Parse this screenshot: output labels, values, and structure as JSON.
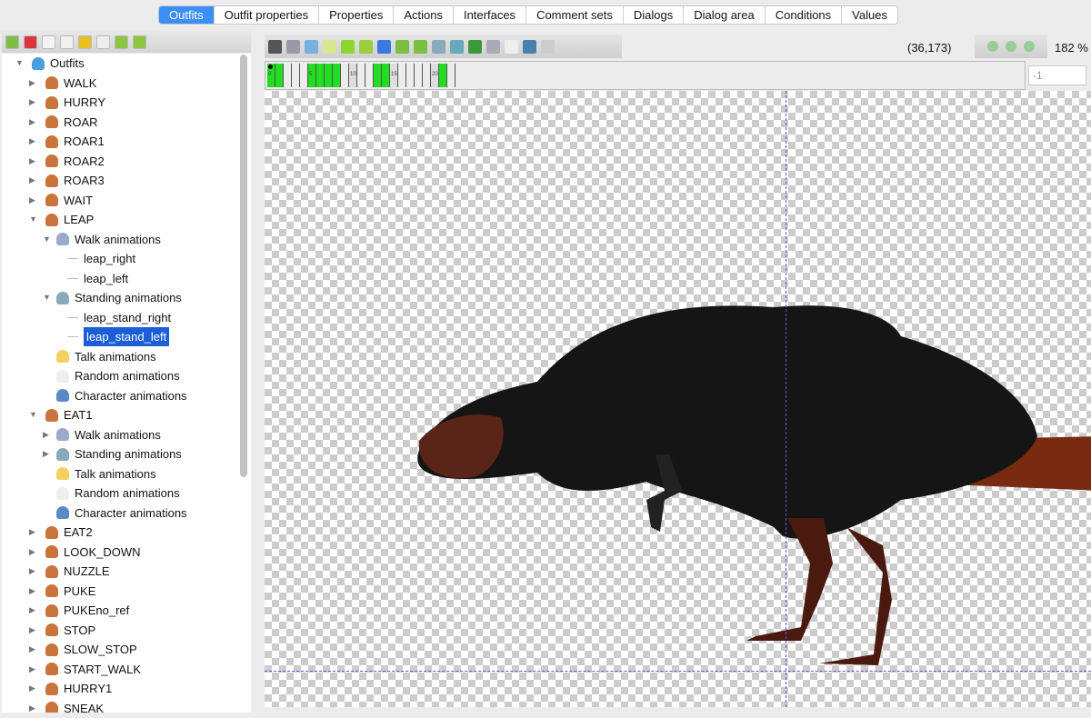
{
  "tabs": [
    "Outfits",
    "Outfit properties",
    "Properties",
    "Actions",
    "Interfaces",
    "Comment sets",
    "Dialogs",
    "Dialog area",
    "Conditions",
    "Values"
  ],
  "tree": [
    {
      "label": "Outfits",
      "level": 0,
      "arrow": "down",
      "icon": "group"
    },
    {
      "label": "WALK",
      "level": 1,
      "arrow": "right",
      "icon": "person"
    },
    {
      "label": "HURRY",
      "level": 1,
      "arrow": "right",
      "icon": "person"
    },
    {
      "label": "ROAR",
      "level": 1,
      "arrow": "right",
      "icon": "person"
    },
    {
      "label": "ROAR1",
      "level": 1,
      "arrow": "right",
      "icon": "person"
    },
    {
      "label": "ROAR2",
      "level": 1,
      "arrow": "right",
      "icon": "person"
    },
    {
      "label": "ROAR3",
      "level": 1,
      "arrow": "right",
      "icon": "person"
    },
    {
      "label": "WAIT",
      "level": 1,
      "arrow": "right",
      "icon": "person"
    },
    {
      "label": "LEAP",
      "level": 1,
      "arrow": "down",
      "icon": "person"
    },
    {
      "label": "Walk animations",
      "level": 2,
      "arrow": "down",
      "icon": "walk"
    },
    {
      "label": "leap_right",
      "level": 3,
      "arrow": "",
      "icon": "line"
    },
    {
      "label": "leap_left",
      "level": 3,
      "arrow": "",
      "icon": "line"
    },
    {
      "label": "Standing animations",
      "level": 2,
      "arrow": "down",
      "icon": "stand"
    },
    {
      "label": "leap_stand_right",
      "level": 3,
      "arrow": "",
      "icon": "line"
    },
    {
      "label": "leap_stand_left",
      "level": 3,
      "arrow": "",
      "icon": "line",
      "selected": true
    },
    {
      "label": "Talk animations",
      "level": 2,
      "arrow": "",
      "icon": "talk"
    },
    {
      "label": "Random animations",
      "level": 2,
      "arrow": "",
      "icon": "clock"
    },
    {
      "label": "Character animations",
      "level": 2,
      "arrow": "",
      "icon": "eye"
    },
    {
      "label": "EAT1",
      "level": 1,
      "arrow": "down",
      "icon": "person"
    },
    {
      "label": "Walk animations",
      "level": 2,
      "arrow": "right",
      "icon": "walk"
    },
    {
      "label": "Standing animations",
      "level": 2,
      "arrow": "right",
      "icon": "stand"
    },
    {
      "label": "Talk animations",
      "level": 2,
      "arrow": "",
      "icon": "talk"
    },
    {
      "label": "Random animations",
      "level": 2,
      "arrow": "",
      "icon": "clock"
    },
    {
      "label": "Character animations",
      "level": 2,
      "arrow": "",
      "icon": "eye"
    },
    {
      "label": "EAT2",
      "level": 1,
      "arrow": "right",
      "icon": "person"
    },
    {
      "label": "LOOK_DOWN",
      "level": 1,
      "arrow": "right",
      "icon": "person"
    },
    {
      "label": "NUZZLE",
      "level": 1,
      "arrow": "right",
      "icon": "person"
    },
    {
      "label": "PUKE",
      "level": 1,
      "arrow": "right",
      "icon": "person"
    },
    {
      "label": "PUKEno_ref",
      "level": 1,
      "arrow": "right",
      "icon": "person"
    },
    {
      "label": "STOP",
      "level": 1,
      "arrow": "right",
      "icon": "person"
    },
    {
      "label": "SLOW_STOP",
      "level": 1,
      "arrow": "right",
      "icon": "person"
    },
    {
      "label": "START_WALK",
      "level": 1,
      "arrow": "right",
      "icon": "person"
    },
    {
      "label": "HURRY1",
      "level": 1,
      "arrow": "right",
      "icon": "person"
    },
    {
      "label": "SNEAK",
      "level": 1,
      "arrow": "right",
      "icon": "person"
    }
  ],
  "left_toolbar": [
    "add-icon",
    "remove-icon",
    "rename-icon",
    "copy-icon",
    "import-icon",
    "paste-icon",
    "move-up-icon",
    "move-down-icon"
  ],
  "view_toolbar": [
    "filmstrip-icon",
    "settings-icon",
    "first-frame-icon",
    "prev-frame-icon",
    "play-icon",
    "next-frame-icon",
    "last-frame-icon",
    "add-frame-icon",
    "remove-frame-icon",
    "edit-frame-icon",
    "add-image-icon",
    "shape-icon",
    "numbering-icon",
    "grid-icon",
    "eye-icon",
    "footprint-icon"
  ],
  "coordinates": "(36,173)",
  "zoom": "182 %",
  "zoom_toolbar": [
    "zoom-in-icon",
    "zoom-reset-icon",
    "zoom-out-icon"
  ],
  "frame_input": "-1",
  "timeline": {
    "frame_count": 23,
    "filled_frames": [
      0,
      1,
      5,
      6,
      7,
      8,
      13,
      14,
      21
    ],
    "labels": {
      "0": "0",
      "5": "5",
      "10": "10",
      "15": "15",
      "20": "20"
    },
    "current_frame": 0
  },
  "colors": {
    "accent": "#3d8ff7",
    "selection": "#1a5fd6",
    "frame_filled": "#22dd22",
    "guide": "#6b4ec7"
  }
}
